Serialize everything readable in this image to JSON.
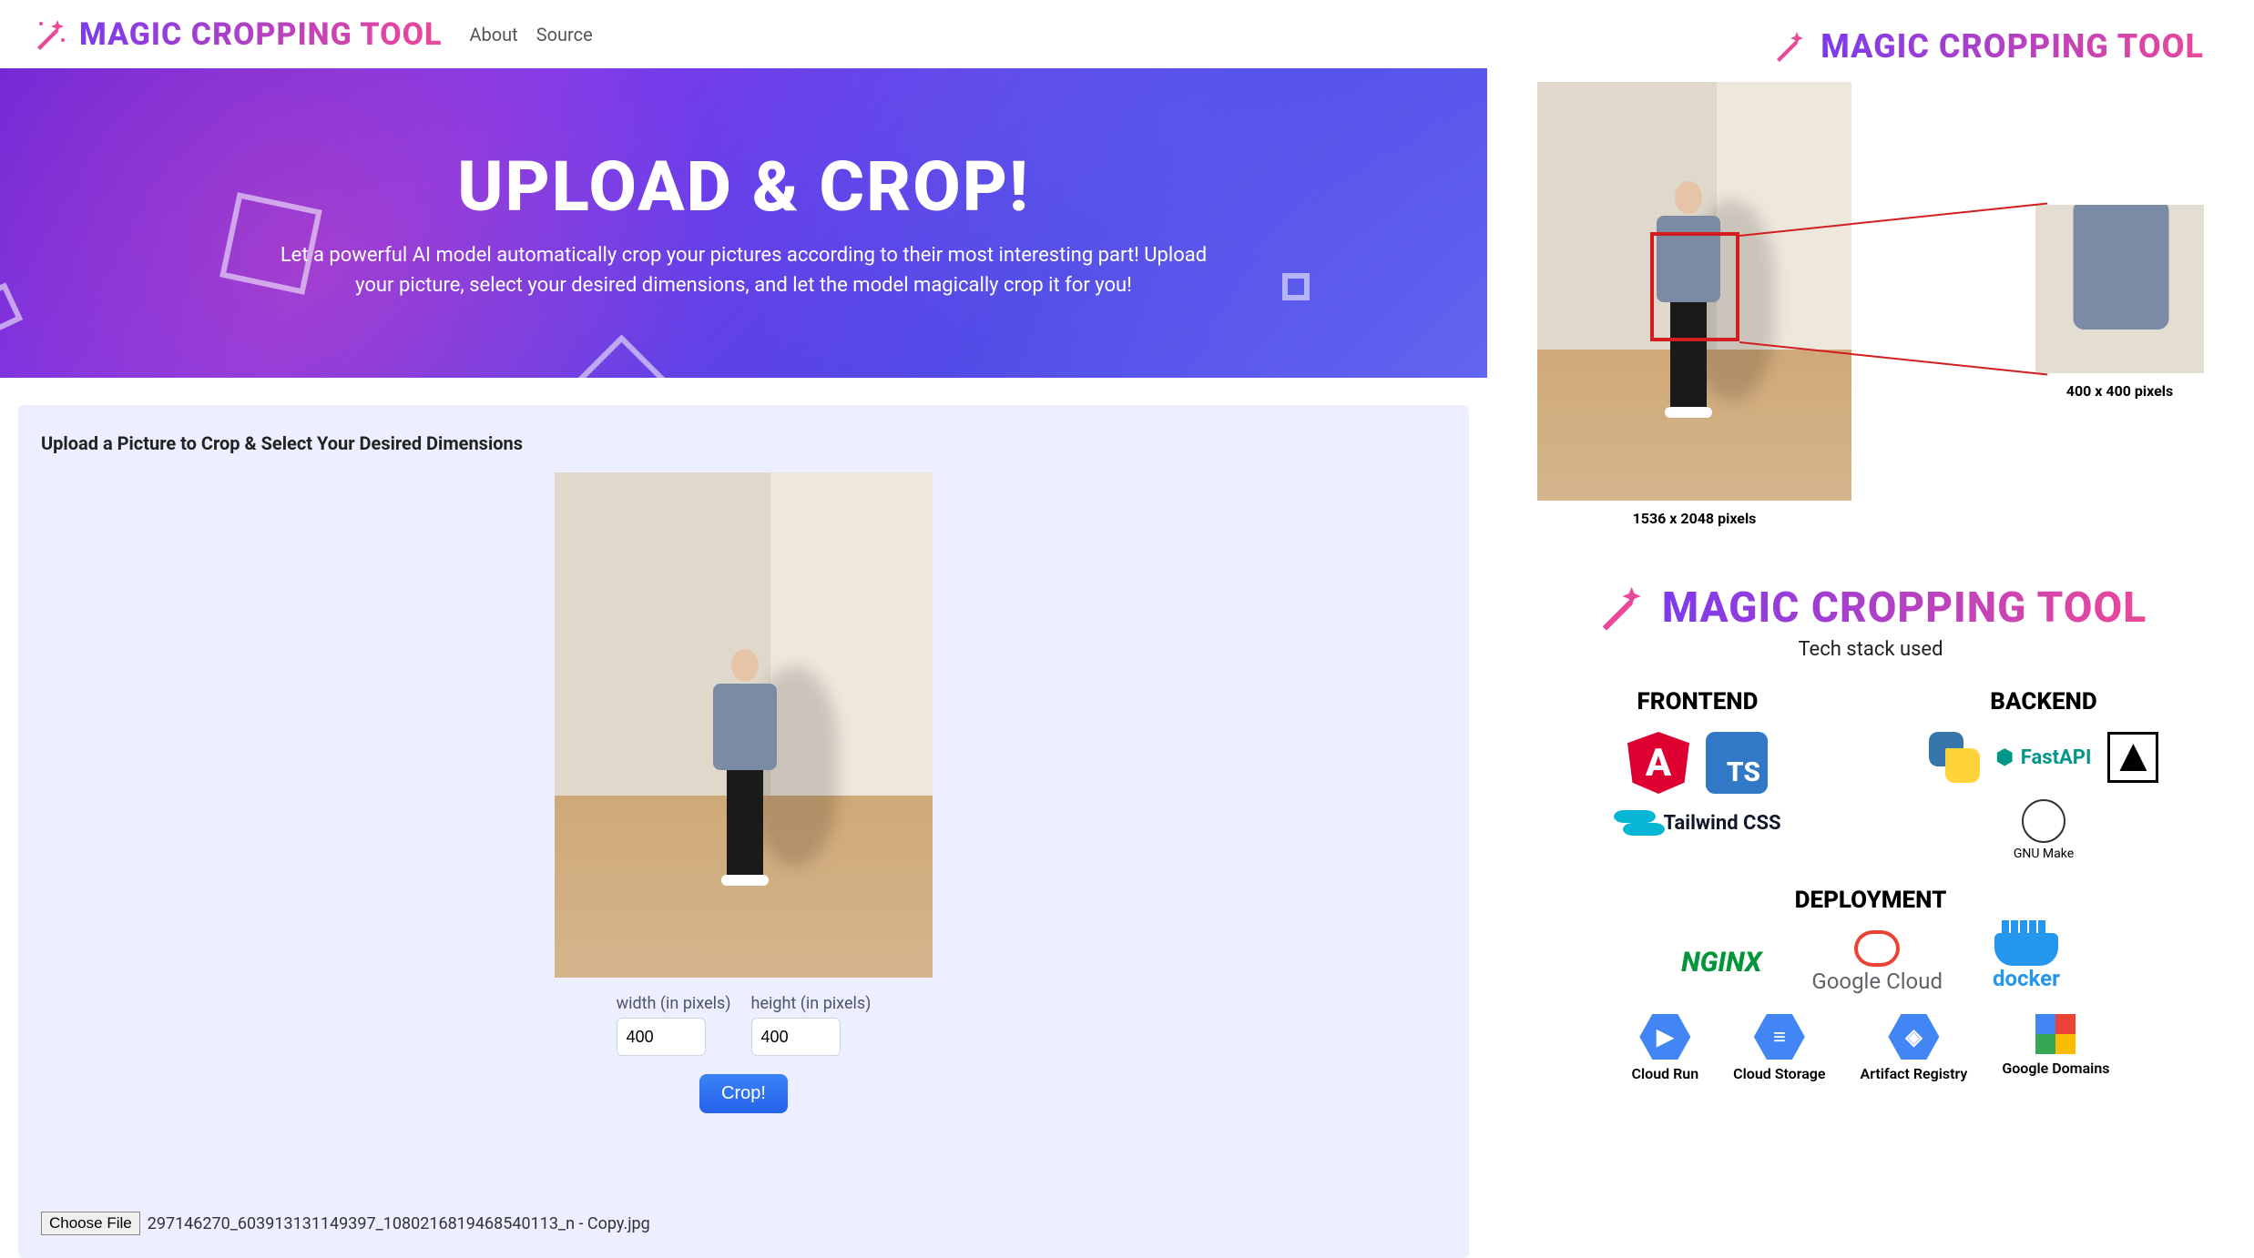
{
  "nav": {
    "app_title": "MAGIC CROPPING TOOL",
    "about": "About",
    "source": "Source"
  },
  "hero": {
    "headline": "UPLOAD & CROP!",
    "sub": "Let a powerful AI model automatically crop your pictures according to their most interesting part! Upload your picture, select your desired dimensions, and let the model magically crop it for you!"
  },
  "card": {
    "title": "Upload a Picture to Crop & Select Your Desired Dimensions",
    "width_label": "width (in pixels)",
    "height_label": "height (in pixels)",
    "width_value": "400",
    "height_value": "400",
    "crop_btn": "Crop!",
    "choose_file_btn": "Choose File",
    "filename": "297146270_603913131149397_1080216819468540113_n - Copy.jpg"
  },
  "demo": {
    "large_caption": "1536 x 2048 pixels",
    "small_caption": "400 x 400 pixels"
  },
  "stack": {
    "heading": "MAGIC CROPPING TOOL",
    "subheading": "Tech stack used",
    "frontend": "FRONTEND",
    "backend": "BACKEND",
    "deployment": "DEPLOYMENT",
    "angular": "A",
    "ts": "TS",
    "tailwind": "Tailwind CSS",
    "fastapi": "FastAPI",
    "gnu": "GNU Make",
    "nginx": "NGINX",
    "gcloud": "Google Cloud",
    "docker": "docker",
    "cloud_run": "Cloud Run",
    "cloud_storage": "Cloud Storage",
    "artifact_registry": "Artifact Registry",
    "google_domains": "Google Domains"
  }
}
